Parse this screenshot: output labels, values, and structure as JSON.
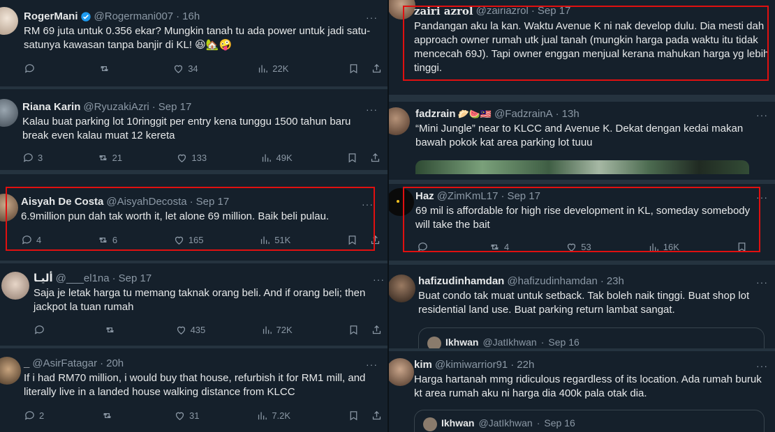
{
  "left_column": {
    "tweets": [
      {
        "name": "RogerMani",
        "verified": true,
        "handle": "@Rogermani007",
        "time": "16h",
        "text": "RM 69 juta untuk 0.356 ekar? Mungkin tanah tu ada power untuk jadi satu-satunya kawasan tanpa banjir di KL! 😆🏡🤪",
        "replies": "",
        "retweets": "",
        "likes": "34",
        "views": "22K"
      },
      {
        "name": "Riana Karin",
        "handle": "@RyuzakiAzri",
        "time": "Sep 17",
        "text": "Kalau buat parking lot 10ringgit per entry kena tunggu 1500 tahun baru break even kalau muat 12 kereta",
        "replies": "3",
        "retweets": "21",
        "likes": "133",
        "views": "49K"
      },
      {
        "name": "Aisyah De Costa",
        "handle": "@AisyahDecosta",
        "time": "Sep 17",
        "text": "6.9million pun dah tak worth it, let alone 69 million. Baik beli pulau.",
        "replies": "4",
        "retweets": "6",
        "likes": "165",
        "views": "51K"
      },
      {
        "name": "أليـا",
        "handle": "@___el1na",
        "time": "Sep 17",
        "text": "Saja je letak harga tu memang taknak orang beli. And if orang beli; then jackpot la tuan rumah",
        "replies": "",
        "retweets": "",
        "likes": "435",
        "views": "72K"
      },
      {
        "name": "_",
        "handle": "@AsirFatagar",
        "time": "20h",
        "text": "If i had RM70 million, i would buy that house, refurbish it for RM1 mill, and literally live in a landed house walking distance from KLCC",
        "replies": "2",
        "retweets": "",
        "likes": "31",
        "views": "7.2K"
      }
    ]
  },
  "right_column": {
    "tweets": [
      {
        "name": "zairi azrol",
        "handle": "@zairiazrol",
        "time": "Sep 17",
        "text": "Pandangan aku la kan. Waktu Avenue K ni nak develop dulu. Dia mesti dah approach owner rumah utk jual tanah (mungkin harga pada waktu itu tidak mencecah 69J). Tapi owner enggan menjual kerana mahukan harga yg lebih tinggi."
      },
      {
        "name": "fadzrain",
        "emoji": "🥟🍉🇲🇾",
        "handle": "@FadzrainA",
        "time": "13h",
        "text": "“Mini Jungle” near to KLCC  and Avenue K. Dekat dengan kedai makan bawah pokok kat area parking lot tuuu"
      },
      {
        "name": "Haz",
        "handle": "@ZimKmL17",
        "time": "Sep 17",
        "text": "69 mil is affordable for high rise development in KL, someday somebody will take the bait",
        "replies": "",
        "retweets": "4",
        "likes": "53",
        "views": "16K"
      },
      {
        "name": "hafizudinhamdan",
        "handle": "@hafizudinhamdan",
        "time": "23h",
        "text": "Buat condo tak muat untuk setback. Tak boleh naik tinggi. Buat shop lot residential land use. Buat parking return lambat sangat.",
        "quote": {
          "name": "Ikhwan",
          "handle": "@JatIkhwan",
          "time": "Sep 16"
        }
      },
      {
        "name": "kim",
        "handle": "@kimiwarrior91",
        "time": "22h",
        "text": "Harga hartanah mmg ridiculous regardless of its location. Ada rumah buruk kt area rumah aku ni harga dia 400k pala otak dia.",
        "quote": {
          "name": "Ikhwan",
          "handle": "@JatIkhwan",
          "time": "Sep 16"
        }
      }
    ]
  },
  "colors": {
    "bg": "#15202b",
    "text": "#e7e9ea",
    "muted": "#8b98a5",
    "verified": "#1d9bf0",
    "highlight": "#e01010"
  },
  "icons": [
    "reply-icon",
    "retweet-icon",
    "like-icon",
    "views-icon",
    "bookmark-icon",
    "share-icon",
    "more-icon",
    "verified-icon"
  ]
}
